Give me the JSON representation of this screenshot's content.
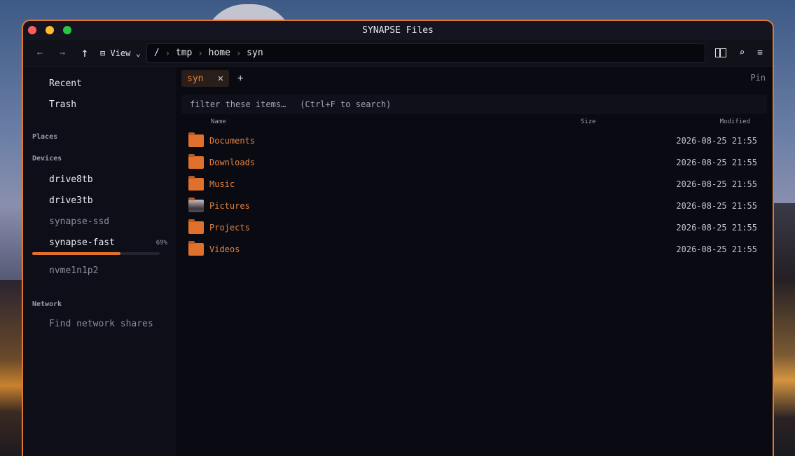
{
  "window": {
    "title": "SYNAPSE Files"
  },
  "toolbar": {
    "back": "←",
    "forward": "→",
    "up": "↑",
    "view_icon": "⊟",
    "view_label": "View",
    "view_chevron": "⌄",
    "path": [
      "/",
      "tmp",
      "home",
      "syn"
    ],
    "path_sep": "›",
    "search_glyph": "⌕",
    "menu_glyph": "≡"
  },
  "sidebar": {
    "quick": [
      {
        "label": "Recent"
      },
      {
        "label": "Trash"
      }
    ],
    "places_heading": "Places",
    "devices_heading": "Devices",
    "devices": [
      {
        "label": "drive8tb",
        "dim": false
      },
      {
        "label": "drive3tb",
        "dim": false
      },
      {
        "label": "synapse-ssd",
        "dim": true
      },
      {
        "label": "synapse-fast",
        "dim": false,
        "usage_label": "69%",
        "usage": 0.69
      },
      {
        "label": "nvme1n1p2",
        "dim": true
      }
    ],
    "network_heading": "Network",
    "network_item": "Find network shares"
  },
  "tabs": {
    "items": [
      {
        "label": "syn",
        "close": "✕"
      }
    ],
    "add": "+",
    "pin_label": "Pin"
  },
  "filter": {
    "placeholder": "filter these items…",
    "hint": "(Ctrl+F to search)"
  },
  "columns": {
    "name": "Name",
    "size": "Size",
    "modified": "Modified"
  },
  "files": [
    {
      "name": "Documents",
      "size": "",
      "modified": "2026-08-25 21:55",
      "icon": "folder-icon"
    },
    {
      "name": "Downloads",
      "size": "",
      "modified": "2026-08-25 21:55",
      "icon": "folder-icon"
    },
    {
      "name": "Music",
      "size": "",
      "modified": "2026-08-25 21:55",
      "icon": "folder-icon"
    },
    {
      "name": "Pictures",
      "size": "",
      "modified": "2026-08-25 21:55",
      "icon": "pictures-folder-icon"
    },
    {
      "name": "Projects",
      "size": "",
      "modified": "2026-08-25 21:55",
      "icon": "folder-icon"
    },
    {
      "name": "Videos",
      "size": "",
      "modified": "2026-08-25 21:55",
      "icon": "folder-icon"
    }
  ],
  "colors": {
    "accent": "#e07a2f",
    "background": "#0b0c15"
  }
}
